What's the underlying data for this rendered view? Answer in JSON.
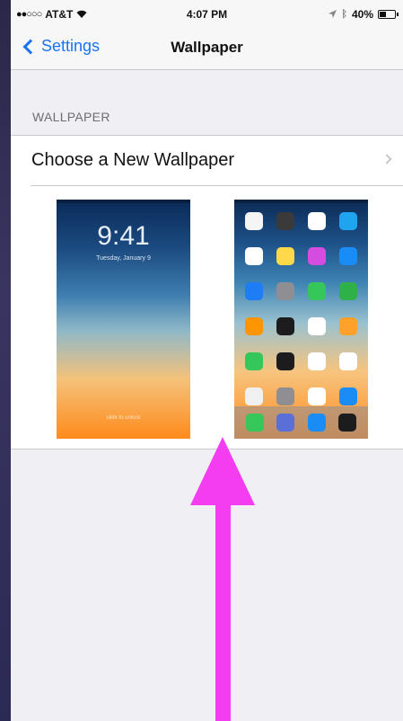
{
  "status_bar": {
    "carrier": "AT&T",
    "time": "4:07 PM",
    "battery": "40%",
    "signal_icon": "signal-dots-icon",
    "wifi_icon": "wifi-icon",
    "location_icon": "location-icon",
    "bluetooth_icon": "bluetooth-icon",
    "battery_icon": "battery-icon"
  },
  "nav": {
    "back_label": "Settings",
    "title": "Wallpaper"
  },
  "section": {
    "header": "WALLPAPER",
    "row_label": "Choose a New Wallpaper"
  },
  "lock_preview": {
    "time": "9:41",
    "date": "Tuesday, January 9",
    "slide_text": "slide to unlock"
  },
  "home_preview": {
    "app_colors": [
      "#f5f5f5",
      "#3a3a3a",
      "#ffffff",
      "#1fa4f0",
      "#ffffff",
      "#ffd94a",
      "#d44ce0",
      "#1a8cf5",
      "#1e7cf5",
      "#8e8e93",
      "#35c759",
      "#2fb14a",
      "#ff9500",
      "#1c1c1e",
      "#ffffff",
      "#ffa12b",
      "#35c759",
      "#1c1c1e",
      "#ffffff",
      "#ffffff",
      "#f0f0f0",
      "#8e8e93",
      "#ffffff",
      "#1a8cf5"
    ],
    "dock_colors": [
      "#35c759",
      "#5b6fd8",
      "#1a8cf5",
      "#1c1c1e"
    ]
  },
  "colors": {
    "accent": "#1a73f0",
    "annotation_arrow": "#f43cf1"
  }
}
